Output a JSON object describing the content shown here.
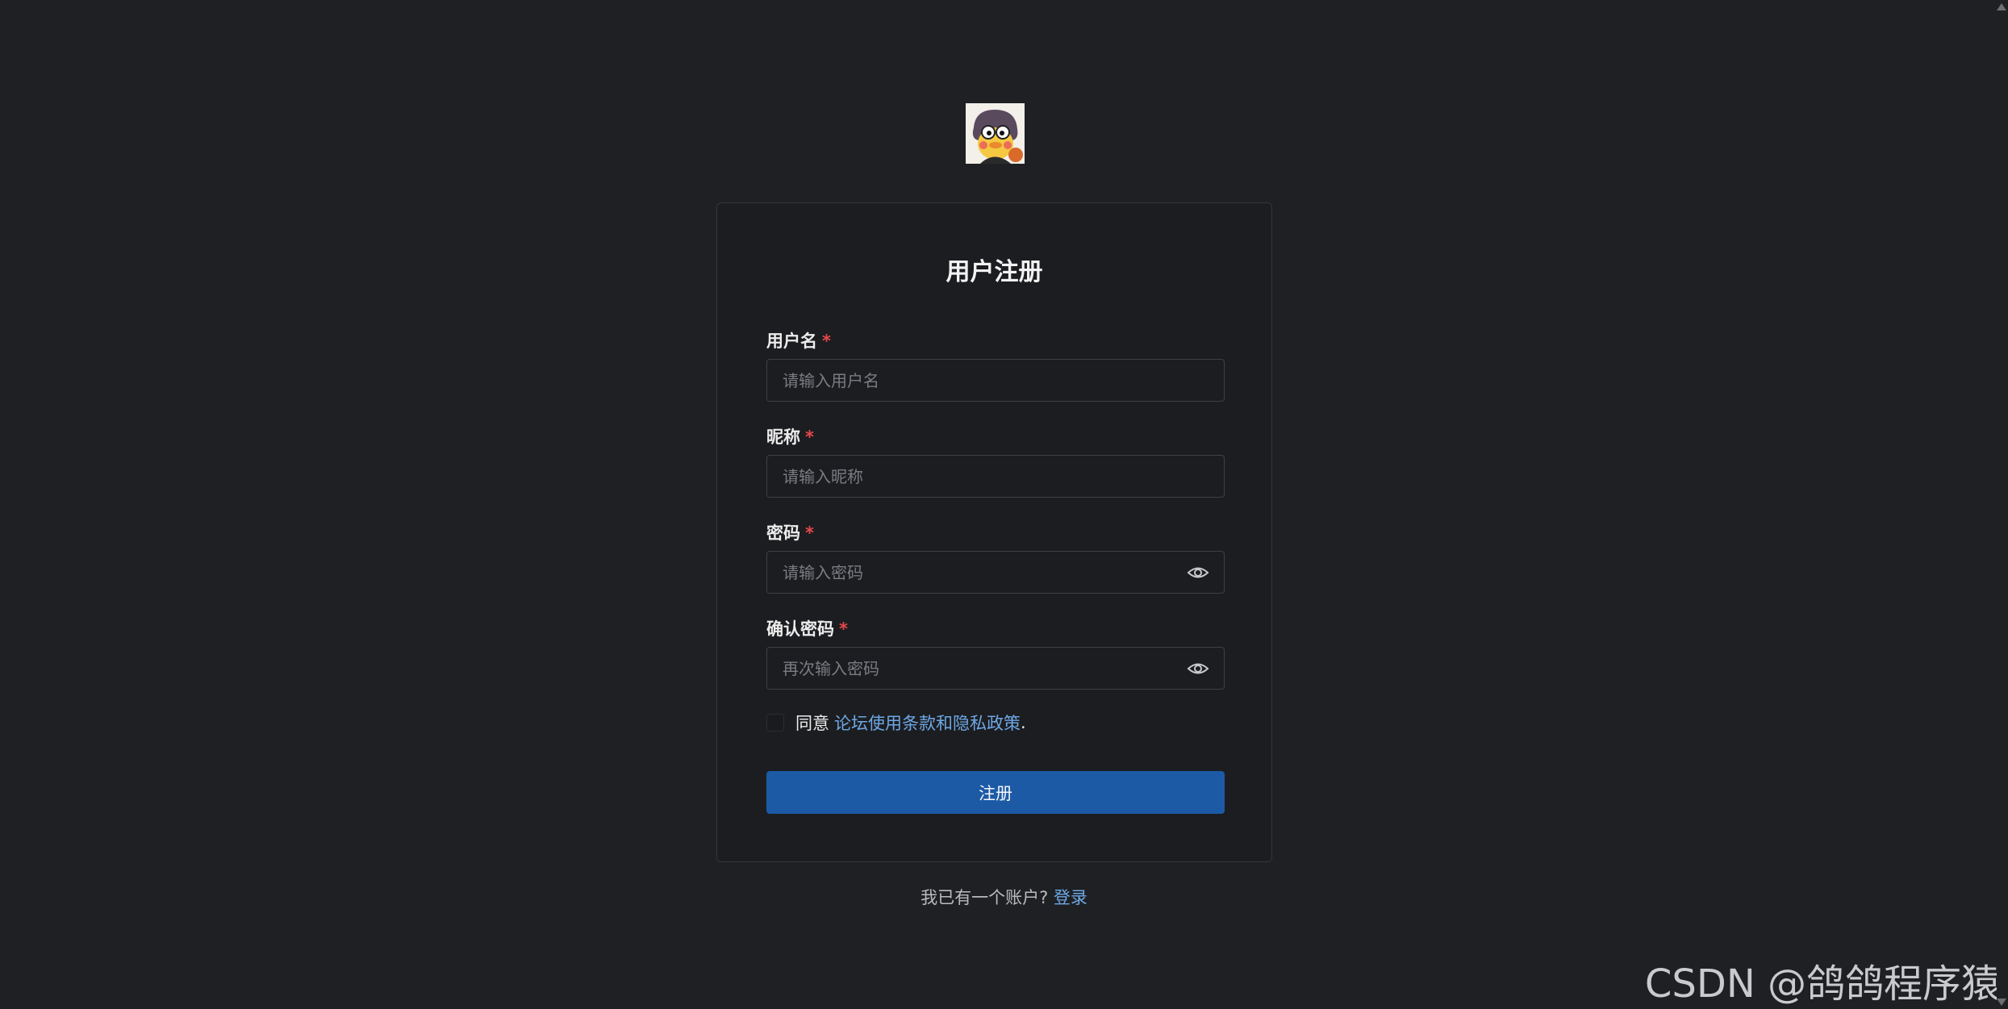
{
  "logo": {
    "icon": "cartoon-avatar-logo"
  },
  "form": {
    "title": "用户注册",
    "required_mark": "*",
    "fields": [
      {
        "label": "用户名",
        "placeholder": "请输入用户名",
        "value": ""
      },
      {
        "label": "昵称",
        "placeholder": "请输入昵称",
        "value": ""
      },
      {
        "label": "密码",
        "placeholder": "请输入密码",
        "value": "",
        "icon": "eye-icon"
      },
      {
        "label": "确认密码",
        "placeholder": "再次输入密码",
        "value": "",
        "icon": "eye-icon"
      }
    ],
    "agree": {
      "prefix": "同意",
      "link_text": "论坛使用条款和隐私政策",
      "suffix": ".",
      "checked": false
    },
    "submit_label": "注册"
  },
  "footer": {
    "prompt": "我已有一个账户? ",
    "login_link": "登录"
  },
  "watermark": "CSDN @鸽鸽程序猿",
  "colors": {
    "background": "#1f2023",
    "card": "#1c1d20",
    "accent": "#1c5aa6",
    "link": "#6ea8e6",
    "required": "#e5484d"
  }
}
